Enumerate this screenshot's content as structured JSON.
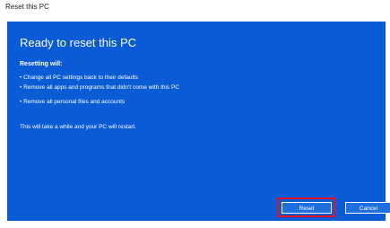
{
  "window": {
    "title": "Reset this PC"
  },
  "panel": {
    "heading": "Ready to reset this PC",
    "subheading": "Resetting will:",
    "bullets": [
      "• Change all PC settings back to their defaults",
      "• Remove all apps and programs that didn't come with this PC",
      "• Remove all personal files and accounts"
    ],
    "note": "This will take a while and your PC will restart."
  },
  "buttons": {
    "primary_label": "Reset",
    "secondary_label": "Cancel"
  },
  "colors": {
    "panel_bg": "#0a5bd6",
    "highlight": "#e81123"
  }
}
